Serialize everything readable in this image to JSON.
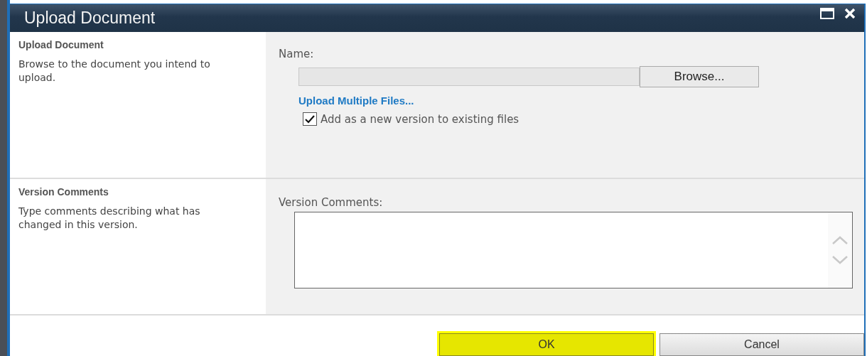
{
  "window": {
    "title": "Upload Document"
  },
  "sections": [
    {
      "kind": "upload",
      "heading": "Upload Document",
      "description": "Browse to the document you intend to upload.",
      "field_label": "Name:",
      "browse_button": "Browse...",
      "link": "Upload Multiple Files...",
      "checkbox": {
        "label": "Add as a new version to existing files",
        "checked": true
      }
    },
    {
      "kind": "comments",
      "heading": "Version Comments",
      "description": "Type comments describing what has changed in this version.",
      "field_label": "Version Comments:"
    }
  ],
  "buttons": [
    {
      "label": "OK",
      "highlighted": true
    },
    {
      "label": "Cancel",
      "highlighted": false
    }
  ]
}
